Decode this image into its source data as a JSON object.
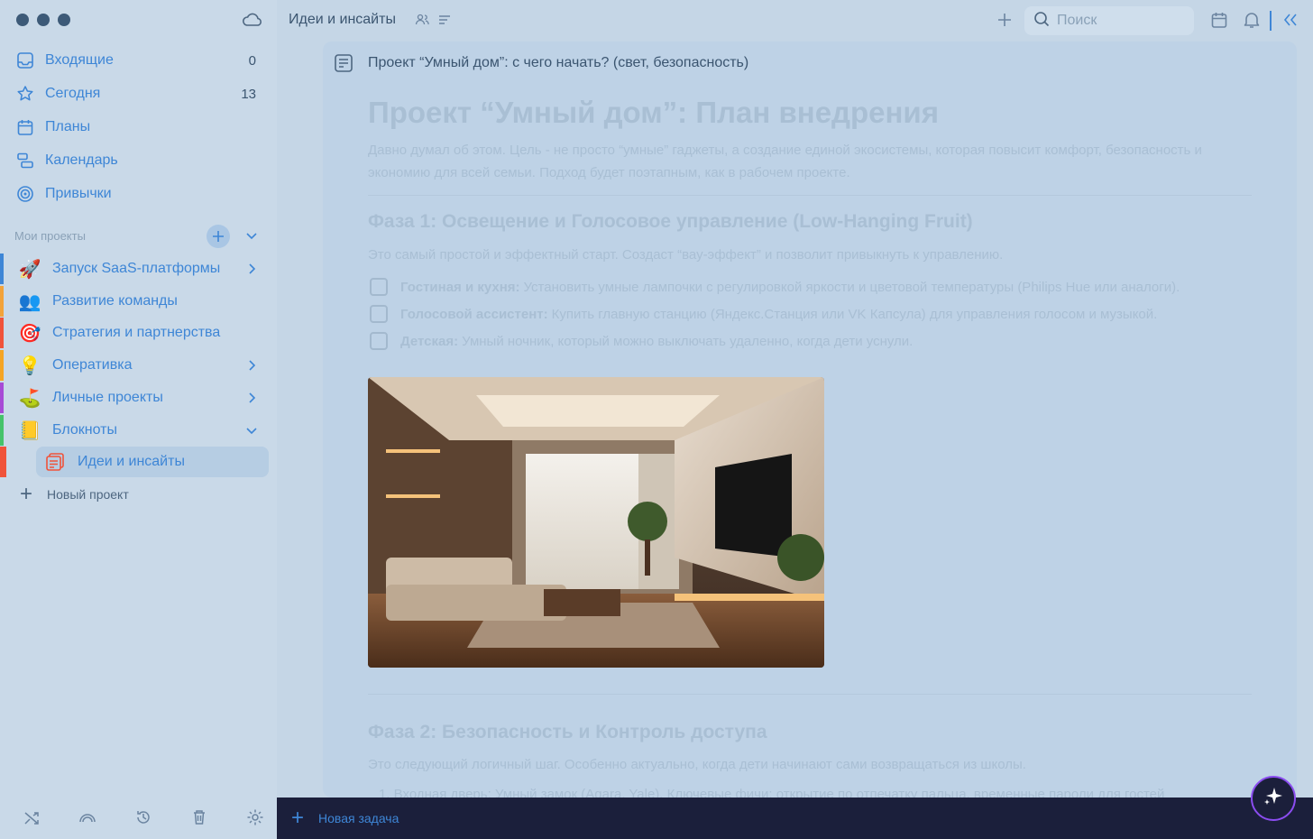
{
  "sidebar": {
    "nav": [
      {
        "label": "Входящие",
        "count": "0",
        "icon": "inbox-icon"
      },
      {
        "label": "Сегодня",
        "count": "13",
        "icon": "star-icon"
      },
      {
        "label": "Планы",
        "count": "",
        "icon": "calendar-icon"
      },
      {
        "label": "Календарь",
        "count": "",
        "icon": "timeline-icon"
      },
      {
        "label": "Привычки",
        "count": "",
        "icon": "target-icon"
      }
    ],
    "section_label": "Мои проекты",
    "projects": [
      {
        "label": "Запуск SaaS-платформы",
        "emoji": "🚀",
        "color": "#3e86d6"
      },
      {
        "label": "Развитие команды",
        "emoji": "👥",
        "color": "#f2a33a"
      },
      {
        "label": "Стратегия и партнерства",
        "emoji": "🎯",
        "color": "#f0533a"
      },
      {
        "label": "Оперативка",
        "emoji": "💡",
        "color": "#f5a524"
      },
      {
        "label": "Личные проекты",
        "emoji": "⛳",
        "color": "#a74bd6"
      },
      {
        "label": "Блокноты",
        "emoji": "📒",
        "color": "#45c36a"
      }
    ],
    "sub_project": {
      "label": "Идеи и инсайты"
    },
    "new_project_label": "Новый проект"
  },
  "topbar": {
    "title": "Идеи и инсайты",
    "search_placeholder": "Поиск"
  },
  "card": {
    "header_title": "Проект “Умный дом”: с чего начать? (свет, безопасность)",
    "doc_title": "Проект “Умный дом”: План внедрения",
    "intro": "Давно думал об этом. Цель - не просто “умные” гаджеты, а создание единой экосистемы, которая повысит комфорт, безопасность и экономию для всей семьи. Подход будет поэтапным, как в рабочем проекте.",
    "phase1_title": "Фаза 1: Освещение и Голосовое управление (Low-Hanging Fruit)",
    "phase1_desc": "Это самый простой и эффектный старт. Создаст “вау-эффект” и позволит привыкнуть к управлению.",
    "tasks": [
      {
        "bold": "Гостиная и кухня:",
        "text": "Установить умные лампочки с регулировкой яркости и цветовой температуры (Philips Hue или аналоги)."
      },
      {
        "bold": "Голосовой ассистент:",
        "text": "Купить главную станцию (Яндекс.Станция или VK Капсула) для управления голосом и музыкой."
      },
      {
        "bold": "Детская:",
        "text": "Умный ночник, который можно выключать удаленно, когда дети уснули."
      }
    ],
    "phase2_title": "Фаза 2: Безопасность и Контроль доступа",
    "phase2_desc": "Это следующий логичный шаг. Особенно актуально, когда дети начинают сами возвращаться из школы.",
    "list_item": "1.   Входная дверь: Умный замок (Aqara, Yale). Ключевые фичи: открытие по отпечатку пальца, временные пароли для гостей"
  },
  "bottombar": {
    "new_task_label": "Новая задача"
  }
}
